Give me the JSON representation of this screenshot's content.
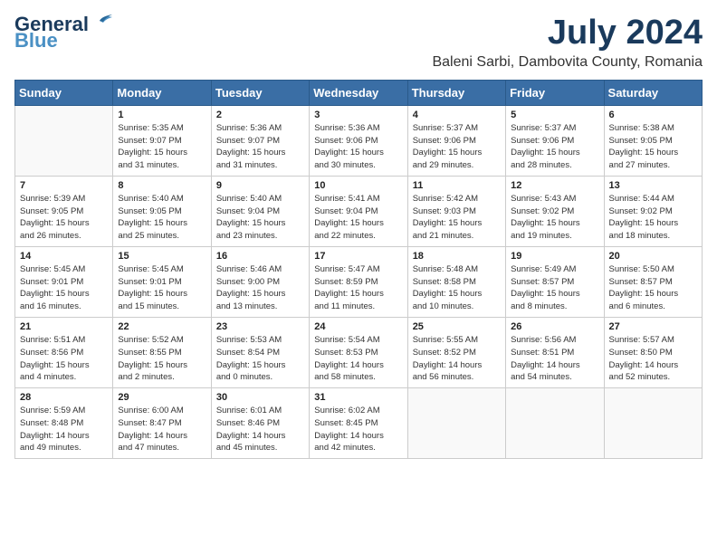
{
  "logo": {
    "line1": "General",
    "line2": "Blue"
  },
  "title": "July 2024",
  "location": "Baleni Sarbi, Dambovita County, Romania",
  "weekdays": [
    "Sunday",
    "Monday",
    "Tuesday",
    "Wednesday",
    "Thursday",
    "Friday",
    "Saturday"
  ],
  "weeks": [
    [
      {
        "day": "",
        "info": ""
      },
      {
        "day": "1",
        "info": "Sunrise: 5:35 AM\nSunset: 9:07 PM\nDaylight: 15 hours\nand 31 minutes."
      },
      {
        "day": "2",
        "info": "Sunrise: 5:36 AM\nSunset: 9:07 PM\nDaylight: 15 hours\nand 31 minutes."
      },
      {
        "day": "3",
        "info": "Sunrise: 5:36 AM\nSunset: 9:06 PM\nDaylight: 15 hours\nand 30 minutes."
      },
      {
        "day": "4",
        "info": "Sunrise: 5:37 AM\nSunset: 9:06 PM\nDaylight: 15 hours\nand 29 minutes."
      },
      {
        "day": "5",
        "info": "Sunrise: 5:37 AM\nSunset: 9:06 PM\nDaylight: 15 hours\nand 28 minutes."
      },
      {
        "day": "6",
        "info": "Sunrise: 5:38 AM\nSunset: 9:05 PM\nDaylight: 15 hours\nand 27 minutes."
      }
    ],
    [
      {
        "day": "7",
        "info": "Sunrise: 5:39 AM\nSunset: 9:05 PM\nDaylight: 15 hours\nand 26 minutes."
      },
      {
        "day": "8",
        "info": "Sunrise: 5:40 AM\nSunset: 9:05 PM\nDaylight: 15 hours\nand 25 minutes."
      },
      {
        "day": "9",
        "info": "Sunrise: 5:40 AM\nSunset: 9:04 PM\nDaylight: 15 hours\nand 23 minutes."
      },
      {
        "day": "10",
        "info": "Sunrise: 5:41 AM\nSunset: 9:04 PM\nDaylight: 15 hours\nand 22 minutes."
      },
      {
        "day": "11",
        "info": "Sunrise: 5:42 AM\nSunset: 9:03 PM\nDaylight: 15 hours\nand 21 minutes."
      },
      {
        "day": "12",
        "info": "Sunrise: 5:43 AM\nSunset: 9:02 PM\nDaylight: 15 hours\nand 19 minutes."
      },
      {
        "day": "13",
        "info": "Sunrise: 5:44 AM\nSunset: 9:02 PM\nDaylight: 15 hours\nand 18 minutes."
      }
    ],
    [
      {
        "day": "14",
        "info": "Sunrise: 5:45 AM\nSunset: 9:01 PM\nDaylight: 15 hours\nand 16 minutes."
      },
      {
        "day": "15",
        "info": "Sunrise: 5:45 AM\nSunset: 9:01 PM\nDaylight: 15 hours\nand 15 minutes."
      },
      {
        "day": "16",
        "info": "Sunrise: 5:46 AM\nSunset: 9:00 PM\nDaylight: 15 hours\nand 13 minutes."
      },
      {
        "day": "17",
        "info": "Sunrise: 5:47 AM\nSunset: 8:59 PM\nDaylight: 15 hours\nand 11 minutes."
      },
      {
        "day": "18",
        "info": "Sunrise: 5:48 AM\nSunset: 8:58 PM\nDaylight: 15 hours\nand 10 minutes."
      },
      {
        "day": "19",
        "info": "Sunrise: 5:49 AM\nSunset: 8:57 PM\nDaylight: 15 hours\nand 8 minutes."
      },
      {
        "day": "20",
        "info": "Sunrise: 5:50 AM\nSunset: 8:57 PM\nDaylight: 15 hours\nand 6 minutes."
      }
    ],
    [
      {
        "day": "21",
        "info": "Sunrise: 5:51 AM\nSunset: 8:56 PM\nDaylight: 15 hours\nand 4 minutes."
      },
      {
        "day": "22",
        "info": "Sunrise: 5:52 AM\nSunset: 8:55 PM\nDaylight: 15 hours\nand 2 minutes."
      },
      {
        "day": "23",
        "info": "Sunrise: 5:53 AM\nSunset: 8:54 PM\nDaylight: 15 hours\nand 0 minutes."
      },
      {
        "day": "24",
        "info": "Sunrise: 5:54 AM\nSunset: 8:53 PM\nDaylight: 14 hours\nand 58 minutes."
      },
      {
        "day": "25",
        "info": "Sunrise: 5:55 AM\nSunset: 8:52 PM\nDaylight: 14 hours\nand 56 minutes."
      },
      {
        "day": "26",
        "info": "Sunrise: 5:56 AM\nSunset: 8:51 PM\nDaylight: 14 hours\nand 54 minutes."
      },
      {
        "day": "27",
        "info": "Sunrise: 5:57 AM\nSunset: 8:50 PM\nDaylight: 14 hours\nand 52 minutes."
      }
    ],
    [
      {
        "day": "28",
        "info": "Sunrise: 5:59 AM\nSunset: 8:48 PM\nDaylight: 14 hours\nand 49 minutes."
      },
      {
        "day": "29",
        "info": "Sunrise: 6:00 AM\nSunset: 8:47 PM\nDaylight: 14 hours\nand 47 minutes."
      },
      {
        "day": "30",
        "info": "Sunrise: 6:01 AM\nSunset: 8:46 PM\nDaylight: 14 hours\nand 45 minutes."
      },
      {
        "day": "31",
        "info": "Sunrise: 6:02 AM\nSunset: 8:45 PM\nDaylight: 14 hours\nand 42 minutes."
      },
      {
        "day": "",
        "info": ""
      },
      {
        "day": "",
        "info": ""
      },
      {
        "day": "",
        "info": ""
      }
    ]
  ]
}
